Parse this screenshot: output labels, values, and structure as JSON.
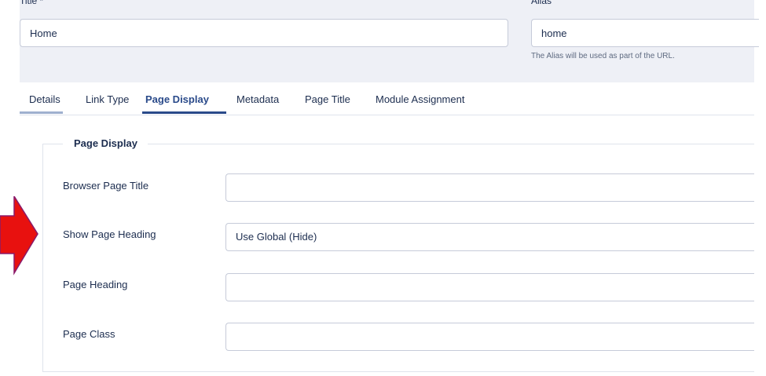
{
  "title_field": {
    "label": "Title *",
    "value": "Home"
  },
  "alias_field": {
    "label": "Alias",
    "value": "home",
    "hint": "The Alias will be used as part of the URL."
  },
  "tabs": [
    {
      "label": "Details"
    },
    {
      "label": "Link Type"
    },
    {
      "label": "Page Display",
      "active": true
    },
    {
      "label": "Metadata"
    },
    {
      "label": "Page Title"
    },
    {
      "label": "Module Assignment"
    }
  ],
  "page_display": {
    "legend": "Page Display",
    "fields": [
      {
        "label": "Browser Page Title",
        "value": ""
      },
      {
        "label": "Show Page Heading",
        "value": "Use Global (Hide)"
      },
      {
        "label": "Page Heading",
        "value": ""
      },
      {
        "label": "Page Class",
        "value": ""
      }
    ]
  },
  "annotation": {
    "icon": "red-arrow-icon",
    "color": "#e8110f"
  },
  "colors": {
    "accent": "#2a4a8a",
    "band": "#eef0f6",
    "text": "#1c2d4f"
  }
}
